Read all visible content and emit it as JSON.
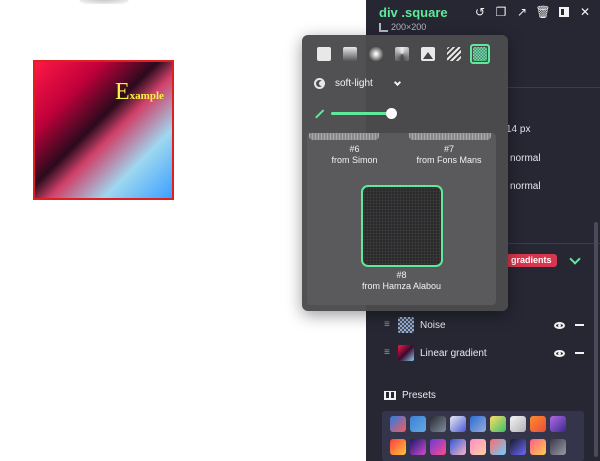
{
  "canvas": {
    "example_text_big": "E",
    "example_text_small": "xample"
  },
  "panel": {
    "title": "div .square",
    "dimensions": "200×200",
    "toolbar": [
      "undo-icon",
      "copy-icon",
      "external-link-icon",
      "trash-icon",
      "layout-icon",
      "close-icon"
    ],
    "tab_fragment": "r",
    "rows": [
      {
        "text": "14  px"
      },
      {
        "text": "normal"
      },
      {
        "text": "normal"
      }
    ],
    "badge": "gradients",
    "layers": [
      {
        "label": "Noise",
        "thumb": "noise-thumbnail"
      },
      {
        "label": "Linear gradient",
        "thumb": "linear-gradient-thumbnail"
      }
    ],
    "presets_title": "Presets",
    "preset_colors": [
      [
        "#2a7be4",
        "#f45c5c"
      ],
      [
        "#3b80d8",
        "#6ad"
      ],
      [
        "#2a2a30",
        "#7f8ea0"
      ],
      [
        "#e9e9ef",
        "#4a5ad8"
      ],
      [
        "#2a6ed0",
        "#9ad"
      ],
      [
        "#ffdd66",
        "#3bbf6b"
      ],
      [
        "#f5f5f5",
        "#b0b0b8"
      ],
      [
        "#ff8b2a",
        "#e84c3d"
      ],
      [
        "#b06ae8",
        "#3a2a8a"
      ],
      [
        "#ff3c3c",
        "#ffc83c"
      ],
      [
        "#1a1a6a",
        "#d14cd1"
      ],
      [
        "#6a3ad8",
        "#ff4c8a"
      ],
      [
        "#2a5ad8",
        "#ffb4c8"
      ],
      [
        "#ff8cc8",
        "#ffd0a0"
      ],
      [
        "#ff6a6a",
        "#6ad0ff"
      ],
      [
        "#1a1a2a",
        "#6a6aff"
      ],
      [
        "#ff5c8a",
        "#ffd04c"
      ],
      [
        "#3a3a4a",
        "#9a9aaa"
      ]
    ]
  },
  "popover": {
    "type_buttons": [
      {
        "name": "solid-color-type-button",
        "sw": "sw-solid",
        "active": false
      },
      {
        "name": "linear-gradient-type-button",
        "sw": "sw-linear",
        "active": false
      },
      {
        "name": "radial-gradient-type-button",
        "sw": "sw-radial",
        "active": false
      },
      {
        "name": "conic-gradient-type-button",
        "sw": "sw-conic",
        "active": false
      },
      {
        "name": "image-type-button",
        "sw": "sw-image",
        "active": false
      },
      {
        "name": "pattern-type-button",
        "sw": "sw-pattern",
        "active": false
      },
      {
        "name": "noise-type-button",
        "sw": "sw-noise",
        "active": true
      }
    ],
    "blend_mode": "soft-light",
    "opacity": 1.0,
    "gallery": [
      {
        "num": "#6",
        "from": "from Simon"
      },
      {
        "num": "#7",
        "from": "from Fons Mans"
      },
      {
        "num": "#8",
        "from": "from Hamza Alabou",
        "selected": true
      }
    ]
  }
}
